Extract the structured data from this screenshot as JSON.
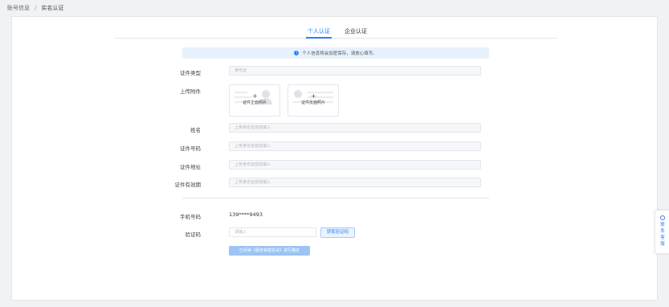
{
  "breadcrumb": {
    "parent": "账号信息",
    "separator": "/",
    "current": "实名认证"
  },
  "tabs": [
    {
      "label": "个人认证"
    },
    {
      "label": "企业认证"
    }
  ],
  "tip": {
    "icon": "info-icon",
    "text": "个人信息将会加密保存，请放心填写。"
  },
  "form": {
    "id_type": {
      "label": "证件类型",
      "placeholder": "身份证"
    },
    "attachment": {
      "label": "上传附件",
      "front": "证件正面照片",
      "back": "证件反面照片"
    },
    "name": {
      "label": "姓名",
      "placeholder": "上传身份证自动填入"
    },
    "id_number": {
      "label": "证件号码",
      "placeholder": "上传身份证自动填入"
    },
    "address": {
      "label": "证件地址",
      "placeholder": "上传身份证自动填入"
    },
    "validity": {
      "label": "证件有效期",
      "placeholder": "上传身份证自动填入"
    },
    "phone": {
      "label": "手机号码",
      "value": "139****9493"
    },
    "code": {
      "label": "验证码",
      "placeholder": "请输入",
      "button": "获取验证码"
    },
    "submit": "已阅读《服务条款协议》进行确定"
  },
  "side": {
    "icon": "support-icon",
    "text": [
      "联",
      "系",
      "客",
      "服"
    ]
  },
  "colors": {
    "accent": "#2d7ff9",
    "tip_bg": "#e8f2fd",
    "submit_bg": "#9cc4f5"
  }
}
